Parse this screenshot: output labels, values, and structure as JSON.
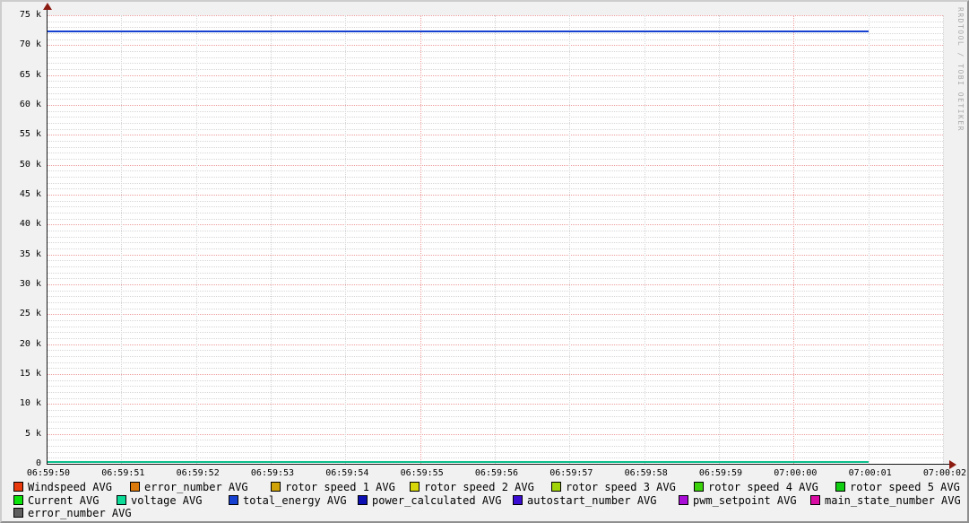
{
  "watermark": "RRDTOOL / TOBI OETIKER",
  "chart_data": {
    "type": "line",
    "title": "",
    "xlabel": "",
    "ylabel": "",
    "ylim": [
      0,
      75000
    ],
    "grid": true,
    "x_ticks": [
      "06:59:50",
      "06:59:51",
      "06:59:52",
      "06:59:53",
      "06:59:54",
      "06:59:55",
      "06:59:56",
      "06:59:57",
      "06:59:58",
      "06:59:59",
      "07:00:00",
      "07:00:01",
      "07:00:02"
    ],
    "y_ticks": [
      {
        "label": "75 k",
        "value": 75000
      },
      {
        "label": "70 k",
        "value": 70000
      },
      {
        "label": "65 k",
        "value": 65000
      },
      {
        "label": "60 k",
        "value": 60000
      },
      {
        "label": "55 k",
        "value": 55000
      },
      {
        "label": "50 k",
        "value": 50000
      },
      {
        "label": "45 k",
        "value": 45000
      },
      {
        "label": "40 k",
        "value": 40000
      },
      {
        "label": "35 k",
        "value": 35000
      },
      {
        "label": "30 k",
        "value": 30000
      },
      {
        "label": "25 k",
        "value": 25000
      },
      {
        "label": "20 k",
        "value": 20000
      },
      {
        "label": "15 k",
        "value": 15000
      },
      {
        "label": "10 k",
        "value": 10000
      },
      {
        "label": "5 k",
        "value": 5000
      },
      {
        "label": "0",
        "value": 0
      }
    ],
    "series": [
      {
        "name": "total_energy AVG",
        "color": "#1640d0",
        "value": 72400,
        "x_start": "06:59:50",
        "x_end": "07:00:01"
      },
      {
        "name": "voltage AVG",
        "color": "#0abf8c",
        "value": 0,
        "x_start": "06:59:50",
        "x_end": "07:00:01"
      }
    ],
    "legend_rows": [
      [
        {
          "label": "Windspeed AVG",
          "color": "#e83a0c"
        },
        {
          "label": "error_number AVG",
          "color": "#db790b"
        },
        {
          "label": "rotor speed 1 AVG",
          "color": "#d0a309"
        },
        {
          "label": "rotor speed 2 AVG",
          "color": "#d6d609"
        },
        {
          "label": "rotor speed 3 AVG",
          "color": "#a0d409"
        },
        {
          "label": "rotor speed 4 AVG",
          "color": "#3bd20c"
        },
        {
          "label": "rotor speed 5 AVG",
          "color": "#12ce12"
        }
      ],
      [
        {
          "label": "Current AVG",
          "color": "#0ce30c"
        },
        {
          "label": "voltage AVG",
          "color": "#0bdb97"
        },
        {
          "label": "total_energy AVG",
          "color": "#1640d0"
        },
        {
          "label": "power_calculated AVG",
          "color": "#0d0fb2"
        },
        {
          "label": "autostart_number AVG",
          "color": "#3b0dd2"
        },
        {
          "label": "pwm_setpoint AVG",
          "color": "#a90cd6"
        },
        {
          "label": "main_state_number AVG",
          "color": "#d90da4"
        }
      ],
      [
        {
          "label": "error_number AVG",
          "color": "#5f5f5f"
        }
      ]
    ]
  }
}
